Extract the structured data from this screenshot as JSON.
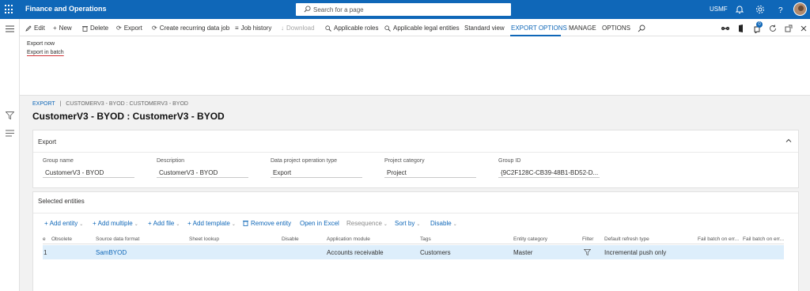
{
  "app": {
    "title": "Finance and Operations",
    "search_placeholder": "Search for a page",
    "company": "USMF",
    "notification_count": "0"
  },
  "action_pane": {
    "items": [
      {
        "label": "Edit",
        "icon": "edit-icon"
      },
      {
        "label": "New",
        "icon": "plus-icon"
      },
      {
        "label": "Delete",
        "icon": "trash-icon"
      },
      {
        "label": "Export",
        "icon": "refresh-icon"
      },
      {
        "label": "Create recurring data job",
        "icon": "refresh-icon"
      },
      {
        "label": "Job history",
        "icon": "list-icon"
      },
      {
        "label": "Download",
        "icon": "download-icon",
        "disabled": true
      },
      {
        "label": "Applicable roles",
        "icon": "search-icon"
      },
      {
        "label": "Applicable legal entities",
        "icon": "search-icon"
      },
      {
        "label": "Standard view"
      }
    ],
    "tabs": [
      "EXPORT OPTIONS",
      "MANAGE",
      "OPTIONS"
    ],
    "active_tab": "EXPORT OPTIONS"
  },
  "export_options_menu": {
    "items": [
      "Export now",
      "Export in batch"
    ]
  },
  "breadcrumb": {
    "root": "EXPORT",
    "separator": "|",
    "path": "CUSTOMERV3 - BYOD : CUSTOMERV3 - BYOD"
  },
  "page_title": "CustomerV3 - BYOD : CustomerV3 - BYOD",
  "export_section": {
    "title": "Export",
    "fields": [
      {
        "label": "Group name",
        "value": "CustomerV3 - BYOD"
      },
      {
        "label": "Description",
        "value": "CustomerV3 - BYOD"
      },
      {
        "label": "Data project operation type",
        "value": "Export"
      },
      {
        "label": "Project category",
        "value": "Project"
      },
      {
        "label": "Group ID",
        "value": "{9C2F128C-CB39-48B1-BD52-D..."
      }
    ]
  },
  "entities_section": {
    "title": "Selected entities",
    "toolbar": [
      {
        "label": "Add entity",
        "prefix": "+",
        "caret": true
      },
      {
        "label": "Add multiple",
        "prefix": "+",
        "caret": true
      },
      {
        "label": "Add file",
        "prefix": "+",
        "caret": true
      },
      {
        "label": "Add template",
        "prefix": "+",
        "caret": true
      },
      {
        "label": "Remove entity",
        "prefix": "🗑",
        "caret": false
      },
      {
        "label": "Open in Excel",
        "prefix": "",
        "caret": false
      },
      {
        "label": "Resequence",
        "prefix": "",
        "caret": true,
        "dim": true
      },
      {
        "label": "Sort by",
        "prefix": "",
        "caret": true
      },
      {
        "label": "Disable",
        "prefix": "",
        "caret": true
      }
    ],
    "columns": [
      "e",
      "Obsolete",
      "Source data format",
      "Sheet lookup",
      "Disable",
      "Application module",
      "Tags",
      "Entity category",
      "Filter",
      "Default refresh type",
      "Fail batch on err...",
      "Fail batch on err..."
    ],
    "rows": [
      {
        "e": "1",
        "obsolete": "",
        "source_data_format": "SamBYOD",
        "sheet_lookup": "",
        "disable": "",
        "application_module": "Accounts receivable",
        "tags": "Customers",
        "entity_category": "Master",
        "filter": "filter-icon",
        "default_refresh_type": "Incremental push only"
      }
    ]
  },
  "colors": {
    "brand": "#0f67b8",
    "selected_row": "#ddeefb",
    "link": "#0f67b8",
    "underline_mark": "#d13438"
  }
}
